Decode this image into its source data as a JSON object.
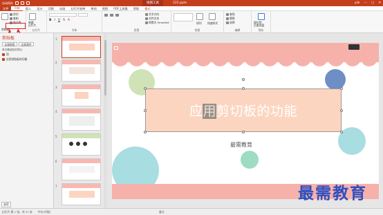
{
  "titlebar": {
    "autosave": "自动保存",
    "drawing_tools": "绘图工具",
    "document": "222.pptx",
    "user": "yzk"
  },
  "menu": {
    "tabs": [
      "文件",
      "开始",
      "插入",
      "设计",
      "切换",
      "动画",
      "幻灯片放映",
      "审阅",
      "视图",
      "PDF工具集",
      "帮助",
      "格式"
    ],
    "active_index": 1
  },
  "ribbon": {
    "clipboard": {
      "label": "剪贴板",
      "cut": "剪切",
      "copy": "复制",
      "format_painter": "格式刷",
      "highlighted": "剪贴板"
    },
    "slides": {
      "label": "幻灯片",
      "new_slide": "新建\n幻灯片"
    },
    "font": {
      "label": "字体"
    },
    "paragraph": {
      "label": "段落",
      "text_direction": "文字方向",
      "align_text": "对齐文本",
      "convert_smartart": "转换为 SmartArt"
    },
    "drawing": {
      "label": "绘图",
      "arrange": "排列",
      "quick_styles": "快速样式"
    },
    "editing": {
      "label": "编辑",
      "find": "查找",
      "replace": "替换",
      "select": "选择"
    },
    "save": {
      "label": "保存",
      "save_to_baidu": "保存到\n百度网盘"
    }
  },
  "clipboard_pane": {
    "title": "剪贴板",
    "paste_all": "全部粘贴",
    "clear_all": "全部清空",
    "hint": "单击要粘贴的项目:",
    "items": [
      "用",
      "应用剪贴板的功能"
    ],
    "options": "选项"
  },
  "thumbnails": {
    "numbers": [
      "1",
      "2",
      "3",
      "4",
      "5",
      "6",
      "7"
    ],
    "selected": 0
  },
  "slide": {
    "title_before": "应",
    "title_highlight": "用",
    "title_after": "剪切板的功能",
    "subtitle": "最需教育"
  },
  "statusbar": {
    "slide_info": "幻灯片 第 1 张，共 21 张",
    "language": "中文(中国)",
    "notes": "备注"
  },
  "watermark": "最需教育",
  "colors": {
    "accent": "#c43e1c",
    "band": "#f7b1ab",
    "title_box": "#fcd5c0",
    "circle_green": "#cfe3b6",
    "circle_blue": "#6e8fc6",
    "circle_cyan": "#a8dde2",
    "circle_mint": "#9edcc4",
    "watermark": "#2c4fc0"
  }
}
